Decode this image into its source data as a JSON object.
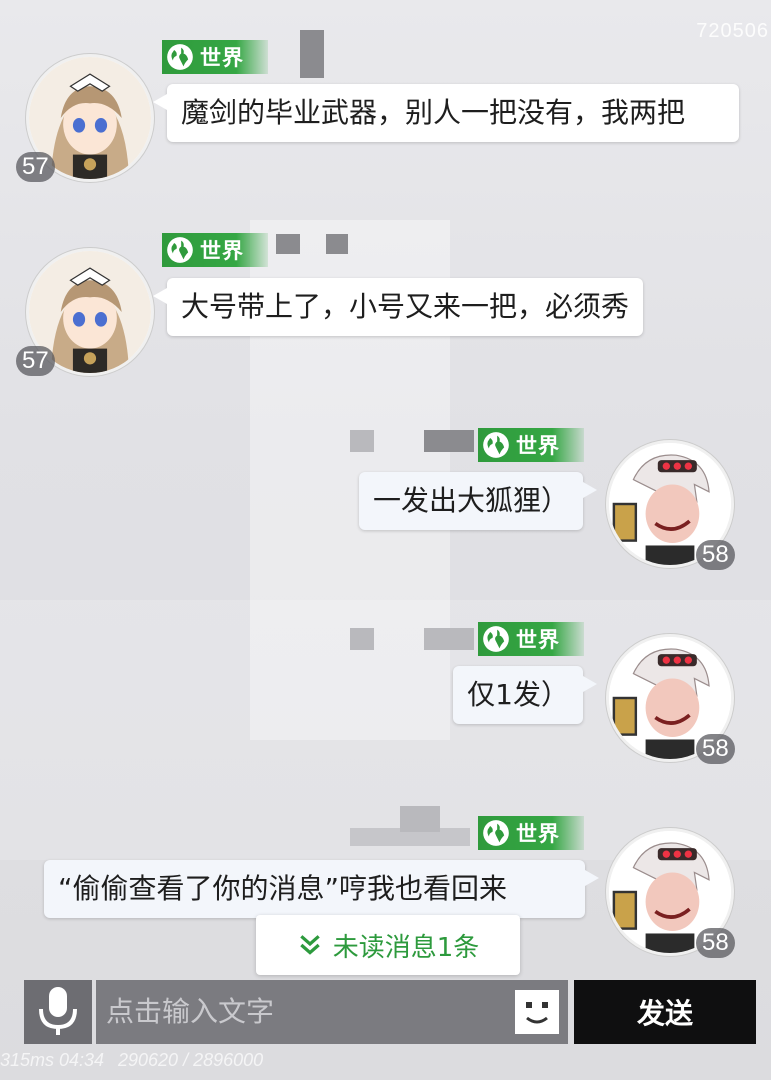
{
  "watermark": "720506",
  "channel_label": "世界",
  "messages": [
    {
      "side": "left",
      "level": "57",
      "text": "魔剑的毕业武器，别人一把没有，我两把"
    },
    {
      "side": "left",
      "level": "57",
      "text": "大号带上了，小号又来一把，必须秀"
    },
    {
      "side": "right",
      "level": "58",
      "text": "一发出大狐狸）"
    },
    {
      "side": "right",
      "level": "58",
      "text": "仅1发）"
    },
    {
      "side": "right",
      "level": "58",
      "text": "“偷偷查看了你的消息”哼我也看回来"
    }
  ],
  "unread_banner": "未读消息1条",
  "input": {
    "placeholder": "点击输入文字"
  },
  "send_label": "发送",
  "footer_left": "315ms 04:34",
  "footer_mid": "290620 / 2896000",
  "colors": {
    "channel_green": "#35a744",
    "send_bg": "#0f0f10",
    "unread_text": "#2d9a3d"
  },
  "icons": [
    "globe-icon",
    "microphone-icon",
    "emoji-icon",
    "double-chevron-down-icon"
  ]
}
